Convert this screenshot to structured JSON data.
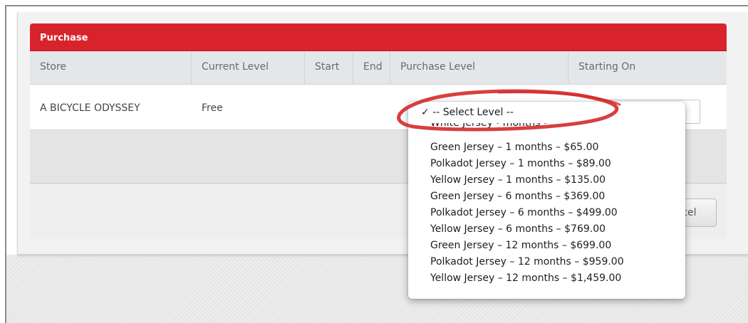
{
  "panel": {
    "title": "Purchase"
  },
  "table": {
    "columns": [
      "Store",
      "Current Level",
      "Start",
      "End",
      "Purchase Level",
      "Starting On"
    ],
    "rows": [
      {
        "store": "A BICYCLE ODYSSEY",
        "current_level": "Free",
        "start": "",
        "end": ""
      }
    ]
  },
  "purchase_select": {
    "selected": "-- Select Level --",
    "check_mark": "✓",
    "options": [
      "-- Select Level --",
      "White Jersey - months -",
      "Green Jersey – 1 months – $65.00",
      "Polkadot Jersey – 1 months – $89.00",
      "Yellow Jersey – 1 months – $135.00",
      "Green Jersey – 6 months – $369.00",
      "Polkadot Jersey – 6 months – $499.00",
      "Yellow Jersey – 6 months – $769.00",
      "Green Jersey – 12 months – $699.00",
      "Polkadot Jersey – 12 months – $959.00",
      "Yellow Jersey – 12 months – $1,459.00"
    ]
  },
  "buttons": {
    "cancel": "ncel"
  },
  "colors": {
    "header": "#d9232c",
    "callout": "#d42a2a"
  }
}
